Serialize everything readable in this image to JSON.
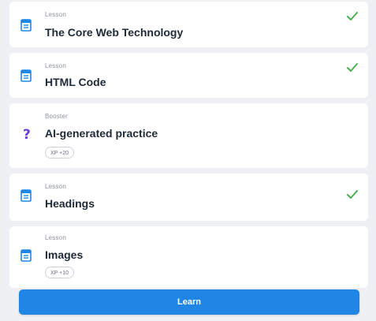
{
  "colors": {
    "accent": "#1f86e6",
    "check": "#4caf50",
    "practice_icon": "#6b3fd4",
    "background": "#eef0f4"
  },
  "items": [
    {
      "kind": "Lesson",
      "title": "The Core Web Technology",
      "icon": "lesson-doc-icon",
      "completed": true
    },
    {
      "kind": "Lesson",
      "title": "HTML Code",
      "icon": "lesson-doc-icon",
      "completed": true
    },
    {
      "kind": "Booster",
      "title": "AI-generated practice",
      "icon": "question-mark-icon",
      "completed": false,
      "xp": "XP +20"
    },
    {
      "kind": "Lesson",
      "title": "Headings",
      "icon": "lesson-doc-icon",
      "completed": true
    },
    {
      "kind": "Lesson",
      "title": "Images",
      "icon": "lesson-doc-icon",
      "completed": false,
      "xp": "XP +10"
    }
  ],
  "learn_button": {
    "label": "Learn"
  }
}
